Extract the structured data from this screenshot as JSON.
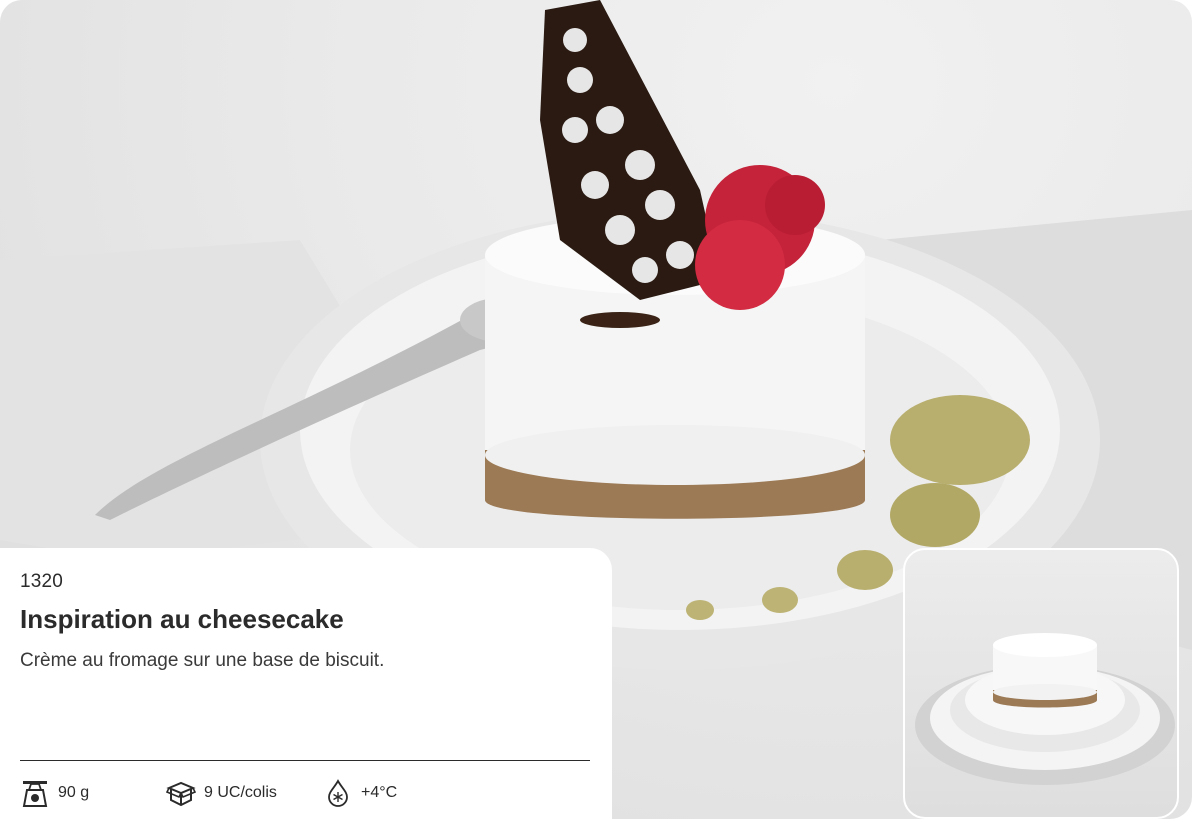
{
  "product": {
    "code": "1320",
    "title": "Inspiration au cheesecake",
    "description": "Crème au fromage sur une base de biscuit."
  },
  "specs": {
    "weight": "90 g",
    "packaging": "9 UC/colis",
    "temperature": "+4°C"
  },
  "icons": {
    "weight": "scale-icon",
    "packaging": "box-icon",
    "temperature": "frozen-drop-icon"
  }
}
